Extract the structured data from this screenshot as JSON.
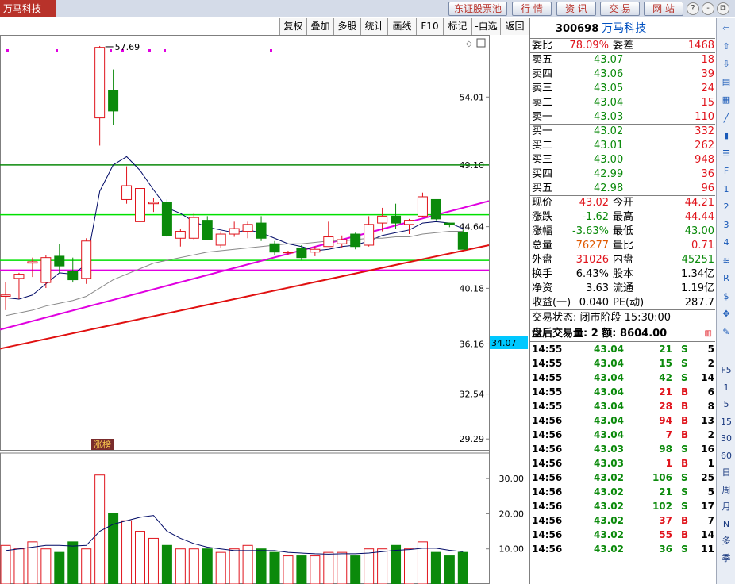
{
  "app": {
    "title": "万马科技"
  },
  "nav": {
    "buttons": [
      "东证股票池",
      "行 情",
      "资 讯",
      "交 易",
      "网 站"
    ],
    "window_controls": [
      "?",
      "-",
      "⧉",
      "×"
    ]
  },
  "toolbar": {
    "buttons": [
      "复权",
      "叠加",
      "多股",
      "统计",
      "画线",
      "F10",
      "标记",
      "-自选",
      "返回"
    ]
  },
  "chart": {
    "price_ticks": [
      "54.01",
      "49.10",
      "44.64",
      "40.18",
      "36.16",
      "32.54",
      "29.29"
    ],
    "current_price_label": "34.07",
    "high_label": "57.69",
    "badge": "涨榜",
    "volume_ticks": [
      "30.00",
      "20.00",
      "10.00"
    ],
    "colors": {
      "up": "#e0141c",
      "down": "#0b8a0b",
      "bg": "#ffffff"
    }
  },
  "chart_data": {
    "type": "candlestick",
    "candles": [
      {
        "o": 39.6,
        "h": 40.6,
        "l": 38.6,
        "c": 39.7
      },
      {
        "o": 40.9,
        "h": 41.3,
        "l": 39.4,
        "c": 41.2
      },
      {
        "o": 42.0,
        "h": 42.4,
        "l": 41.0,
        "c": 42.1
      },
      {
        "o": 40.6,
        "h": 42.6,
        "l": 40.2,
        "c": 42.4
      },
      {
        "o": 42.5,
        "h": 43.4,
        "l": 41.3,
        "c": 41.8
      },
      {
        "o": 41.4,
        "h": 42.4,
        "l": 40.6,
        "c": 40.8
      },
      {
        "o": 40.9,
        "h": 43.8,
        "l": 40.5,
        "c": 43.6
      },
      {
        "o": 52.5,
        "h": 57.7,
        "l": 50.5,
        "c": 57.6
      },
      {
        "o": 54.5,
        "h": 56.0,
        "l": 52.0,
        "c": 53.0
      },
      {
        "o": 46.6,
        "h": 49.0,
        "l": 46.3,
        "c": 47.6
      },
      {
        "o": 45.0,
        "h": 48.0,
        "l": 44.3,
        "c": 47.4
      },
      {
        "o": 46.3,
        "h": 46.7,
        "l": 45.7,
        "c": 46.4
      },
      {
        "o": 46.4,
        "h": 46.6,
        "l": 43.9,
        "c": 44.0
      },
      {
        "o": 43.8,
        "h": 44.5,
        "l": 43.2,
        "c": 44.3
      },
      {
        "o": 43.8,
        "h": 45.6,
        "l": 43.7,
        "c": 45.3
      },
      {
        "o": 45.1,
        "h": 45.4,
        "l": 43.7,
        "c": 43.7
      },
      {
        "o": 43.3,
        "h": 44.3,
        "l": 43.1,
        "c": 44.1
      },
      {
        "o": 44.1,
        "h": 45.0,
        "l": 43.9,
        "c": 44.5
      },
      {
        "o": 44.3,
        "h": 45.0,
        "l": 43.8,
        "c": 44.8
      },
      {
        "o": 44.9,
        "h": 45.4,
        "l": 43.6,
        "c": 43.8
      },
      {
        "o": 43.4,
        "h": 43.6,
        "l": 42.6,
        "c": 42.8
      },
      {
        "o": 42.8,
        "h": 42.9,
        "l": 42.6,
        "c": 42.8
      },
      {
        "o": 43.1,
        "h": 43.3,
        "l": 42.2,
        "c": 42.4
      },
      {
        "o": 42.8,
        "h": 43.2,
        "l": 42.5,
        "c": 43.0
      },
      {
        "o": 43.2,
        "h": 45.0,
        "l": 43.2,
        "c": 43.9
      },
      {
        "o": 43.4,
        "h": 44.0,
        "l": 43.1,
        "c": 43.7
      },
      {
        "o": 44.1,
        "h": 44.2,
        "l": 43.0,
        "c": 43.2
      },
      {
        "o": 43.3,
        "h": 45.4,
        "l": 43.2,
        "c": 44.8
      },
      {
        "o": 44.9,
        "h": 46.0,
        "l": 44.3,
        "c": 45.4
      },
      {
        "o": 45.4,
        "h": 46.3,
        "l": 44.5,
        "c": 44.9
      },
      {
        "o": 44.8,
        "h": 45.2,
        "l": 44.1,
        "c": 45.1
      },
      {
        "o": 45.4,
        "h": 47.1,
        "l": 45.3,
        "c": 46.8
      },
      {
        "o": 46.6,
        "h": 46.6,
        "l": 45.1,
        "c": 45.2
      },
      {
        "o": 44.9,
        "h": 44.9,
        "l": 44.6,
        "c": 44.8
      },
      {
        "o": 44.2,
        "h": 44.4,
        "l": 43.0,
        "c": 43.0
      }
    ],
    "volume": [
      11,
      10,
      12,
      10,
      9,
      12,
      10,
      31,
      20,
      18,
      15,
      13,
      11,
      10,
      10,
      10,
      9,
      10,
      11,
      10,
      9,
      8,
      8,
      8,
      9,
      9,
      8,
      10,
      10,
      11,
      10,
      12,
      9,
      8,
      9
    ],
    "ma_price": [
      [
        39.5,
        39.4,
        39.7,
        40.5,
        41.3,
        41.2,
        41.9,
        47.2,
        49.1,
        49.7,
        48.7,
        47.3,
        46.0,
        45.6,
        45.0,
        44.6,
        44.4,
        44.2,
        44.4,
        44.2,
        43.8,
        43.4,
        43.2,
        42.9,
        43.0,
        43.2,
        43.3,
        43.6,
        44.0,
        44.2,
        44.4,
        44.9,
        45.0,
        44.9,
        44.5
      ],
      [
        38.2,
        38.4,
        38.6,
        38.9,
        39.1,
        39.3,
        39.6,
        40.2,
        40.8,
        41.2,
        41.6,
        42.0,
        42.2,
        42.4,
        42.6,
        42.8,
        42.9,
        43.0,
        43.1,
        43.2,
        43.3,
        43.4,
        43.4,
        43.5,
        43.6,
        43.6,
        43.7,
        43.8,
        43.8,
        43.9,
        43.9,
        44.1,
        44.2,
        44.3,
        44.3
      ]
    ],
    "ma_volume": [
      9.5,
      10,
      10.5,
      11,
      11,
      10.8,
      11,
      15,
      17,
      18,
      19,
      19.5,
      15,
      13,
      11.5,
      10.5,
      10,
      9.5,
      9.5,
      9.5,
      9.5,
      9,
      8.8,
      8.6,
      8.5,
      8.6,
      8.6,
      8.8,
      9.2,
      9.6,
      9.8,
      10.2,
      10.2,
      9.6,
      9.2
    ],
    "hlines": [
      {
        "price": 49.1,
        "color": "#0b8a0b"
      },
      {
        "price": 45.5,
        "color": "#00e000"
      },
      {
        "price": 42.2,
        "color": "#00e000"
      },
      {
        "price": 41.5,
        "color": "#e000e0"
      }
    ],
    "trendlines": [
      {
        "from": [
          0,
          37.3
        ],
        "to": [
          34,
          46.0
        ],
        "color": "#e000e0"
      },
      {
        "from": [
          0,
          35.9
        ],
        "to": [
          34,
          42.9
        ],
        "color": "#e01010"
      }
    ],
    "ylim": [
      28.5,
      58.5
    ],
    "volume_ylim": [
      0,
      35
    ]
  },
  "quote": {
    "code": "300698",
    "name": "万马科技",
    "weibi": {
      "label": "委比",
      "value": "78.09%",
      "label2": "委差",
      "value2": "1468"
    },
    "asks": [
      {
        "label": "卖五",
        "price": "43.07",
        "vol": "18"
      },
      {
        "label": "卖四",
        "price": "43.06",
        "vol": "39"
      },
      {
        "label": "卖三",
        "price": "43.05",
        "vol": "24"
      },
      {
        "label": "卖二",
        "price": "43.04",
        "vol": "15"
      },
      {
        "label": "卖一",
        "price": "43.03",
        "vol": "110"
      }
    ],
    "bids": [
      {
        "label": "买一",
        "price": "43.02",
        "vol": "332"
      },
      {
        "label": "买二",
        "price": "43.01",
        "vol": "262"
      },
      {
        "label": "买三",
        "price": "43.00",
        "vol": "948"
      },
      {
        "label": "买四",
        "price": "42.99",
        "vol": "36"
      },
      {
        "label": "买五",
        "price": "42.98",
        "vol": "96"
      }
    ],
    "stats1": [
      {
        "l1": "现价",
        "v1": "43.02",
        "l2": "今开",
        "v2": "44.21"
      },
      {
        "l1": "涨跌",
        "v1": "-1.62",
        "l2": "最高",
        "v2": "44.44"
      },
      {
        "l1": "涨幅",
        "v1": "-3.63%",
        "l2": "最低",
        "v2": "43.00"
      },
      {
        "l1": "总量",
        "v1": "76277",
        "l2": "量比",
        "v2": "0.71"
      },
      {
        "l1": "外盘",
        "v1": "31026",
        "l2": "内盘",
        "v2": "45251"
      }
    ],
    "stats2": [
      {
        "l1": "换手",
        "v1": "6.43%",
        "l2": "股本",
        "v2": "1.34亿"
      },
      {
        "l1": "净资",
        "v1": "3.63",
        "l2": "流通",
        "v2": "1.19亿"
      },
      {
        "l1": "收益(一)",
        "v1": "0.040",
        "l2": "PE(动)",
        "v2": "287.7"
      }
    ],
    "status": "交易状态: 闭市阶段 15:30:00",
    "after": "盘后交易量: 2  额: 8604.00"
  },
  "ticks": [
    {
      "time": "14:55",
      "price": "43.04",
      "vol": "21",
      "dir": "S",
      "n": "5"
    },
    {
      "time": "14:55",
      "price": "43.04",
      "vol": "15",
      "dir": "S",
      "n": "2"
    },
    {
      "time": "14:55",
      "price": "43.04",
      "vol": "42",
      "dir": "S",
      "n": "14"
    },
    {
      "time": "14:55",
      "price": "43.04",
      "vol": "21",
      "dir": "B",
      "n": "6"
    },
    {
      "time": "14:55",
      "price": "43.04",
      "vol": "28",
      "dir": "B",
      "n": "8"
    },
    {
      "time": "14:56",
      "price": "43.04",
      "vol": "94",
      "dir": "B",
      "n": "13"
    },
    {
      "time": "14:56",
      "price": "43.04",
      "vol": "7",
      "dir": "B",
      "n": "2"
    },
    {
      "time": "14:56",
      "price": "43.03",
      "vol": "98",
      "dir": "S",
      "n": "16"
    },
    {
      "time": "14:56",
      "price": "43.03",
      "vol": "1",
      "dir": "B",
      "n": "1"
    },
    {
      "time": "14:56",
      "price": "43.02",
      "vol": "106",
      "dir": "S",
      "n": "25"
    },
    {
      "time": "14:56",
      "price": "43.02",
      "vol": "21",
      "dir": "S",
      "n": "5"
    },
    {
      "time": "14:56",
      "price": "43.02",
      "vol": "102",
      "dir": "S",
      "n": "17"
    },
    {
      "time": "14:56",
      "price": "43.02",
      "vol": "37",
      "dir": "B",
      "n": "7"
    },
    {
      "time": "14:56",
      "price": "43.02",
      "vol": "55",
      "dir": "B",
      "n": "14"
    },
    {
      "time": "14:56",
      "price": "43.02",
      "vol": "36",
      "dir": "S",
      "n": "11"
    }
  ],
  "sidebar": {
    "icons": [
      "back-arrow-icon",
      "up-arrow-icon",
      "down-arrow-icon",
      "report-icon",
      "grid-icon",
      "line-chart-icon",
      "candle-icon",
      "list-icon",
      "f10-icon",
      "f1-icon",
      "f2-icon",
      "f3-icon",
      "f4-icon",
      "wave-icon",
      "rsi-icon",
      "dollar-icon",
      "move-icon",
      "pencil-icon"
    ],
    "labels": [
      "F5",
      "1",
      "5",
      "15",
      "30",
      "60",
      "日",
      "周",
      "月",
      "N",
      "多",
      "季"
    ]
  }
}
